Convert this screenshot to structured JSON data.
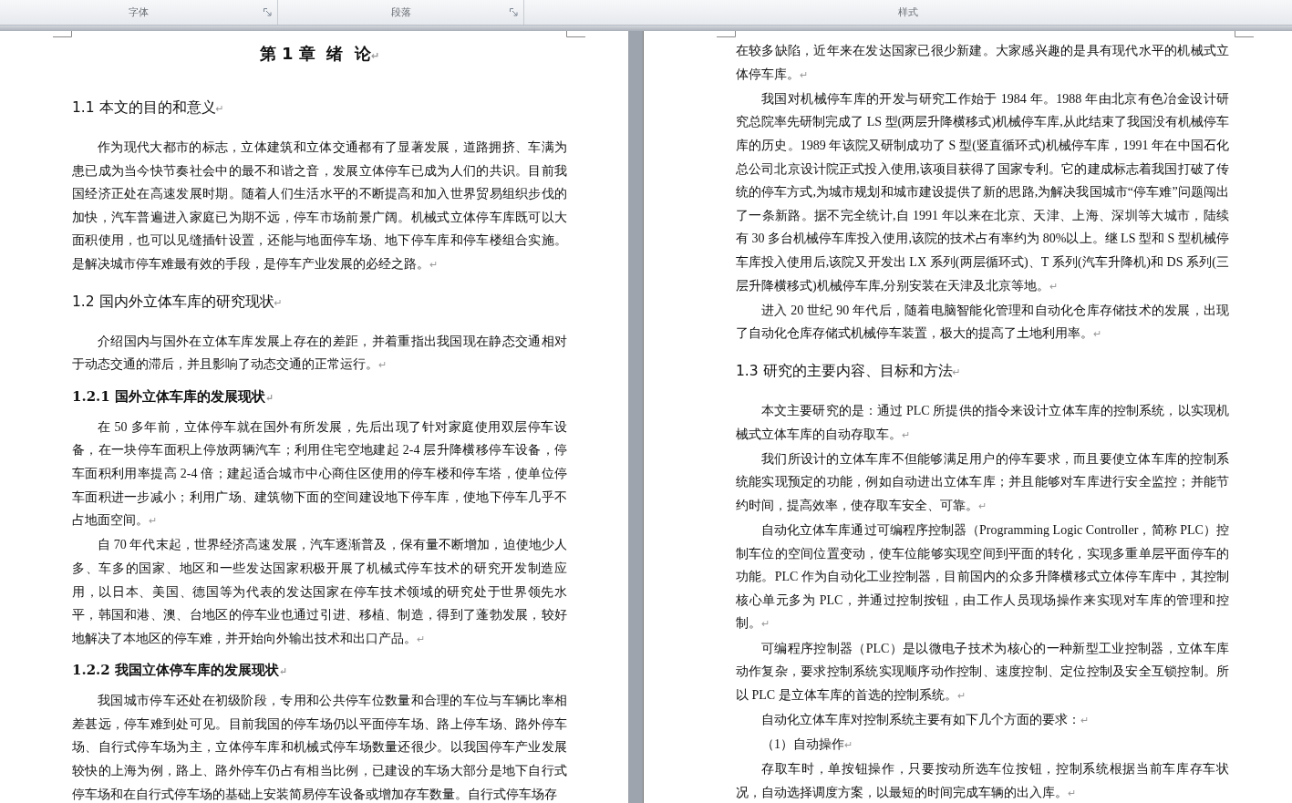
{
  "ribbon": {
    "groups": [
      {
        "label": "字体",
        "launcher": true
      },
      {
        "label": "段落",
        "launcher": true
      },
      {
        "label": "样式"
      }
    ]
  },
  "pages": [
    {
      "blocks": [
        {
          "kind": "title",
          "text": "第 1 章  绪  论",
          "end_mark": "↵"
        },
        {
          "kind": "heading2",
          "text": "1.1 本文的目的和意义",
          "end_mark": "↵"
        },
        {
          "kind": "paragraph",
          "text": "作为现代大都市的标志，立体建筑和立体交通都有了显著发展，道路拥挤、车满为患已成为当今快节奏社会中的最不和谐之音，发展立体停车已成为人们的共识。目前我国经济正处在高速发展时期。随着人们生活水平的不断提高和加入世界贸易组织步伐的加快，汽车普遍进入家庭已为期不远，停车市场前景广阔。机械式立体停车库既可以大面积使用，也可以见缝插针设置，还能与地面停车场、地下停车库和停车楼组合实施。是解决城市停车难最有效的手段，是停车产业发展的必经之路。",
          "end_mark": "↵"
        },
        {
          "kind": "heading2",
          "text": "1.2 国内外立体车库的研究现状",
          "end_mark": "↵"
        },
        {
          "kind": "paragraph",
          "text": "介绍国内与国外在立体车库发展上存在的差距，并着重指出我国现在静态交通相对于动态交通的滞后，并且影响了动态交通的正常运行。",
          "end_mark": "↵"
        },
        {
          "kind": "heading3",
          "text": "1.2.1 国外立体车库的发展现状",
          "end_mark": "↵"
        },
        {
          "kind": "paragraph",
          "text": "在 50 多年前，立体停车就在国外有所发展，先后出现了针对家庭使用双层停车设备，在一块停车面积上停放两辆汽车；利用住宅空地建起 2-4 层升降横移停车设备，停车面积利用率提高 2-4 倍；建起适合城市中心商住区使用的停车楼和停车塔，使单位停车面积进一步减小；利用广场、建筑物下面的空间建设地下停车库，使地下停车几乎不占地面空间。",
          "end_mark": "↵"
        },
        {
          "kind": "paragraph",
          "text": "自 70 年代末起，世界经济高速发展，汽车逐渐普及，保有量不断增加，迫使地少人多、车多的国家、地区和一些发达国家积极开展了机械式停车技术的研究开发制造应用，以日本、美国、德国等为代表的发达国家在停车技术领域的研究处于世界领先水平，韩国和港、澳、台地区的停车业也通过引进、移植、制造，得到了蓬勃发展，较好地解决了本地区的停车难，并开始向外输出技术和出口产品。",
          "end_mark": "↵"
        },
        {
          "kind": "heading3",
          "text": "1.2.2 我国立体停车库的发展现状",
          "end_mark": "↵"
        },
        {
          "kind": "paragraph",
          "text": "我国城市停车还处在初级阶段，专用和公共停车位数量和合理的车位与车辆比率相差甚远，停车难到处可见。目前我国的停车场仍以平面停车场、路上停车场、路外停车场、自行式停车场为主，立体停车库和机械式停车场数量还很少。以我国停车产业发展较快的上海为例，路上、路外停车仍占有相当比例，已建设的车场大部分是地下自行式停车场和在自行式停车场的基础上安装简易停车设备或增加存车数量。自行式停车场存"
        }
      ]
    },
    {
      "blocks": [
        {
          "kind": "continued",
          "text": "在较多缺陷，近年来在发达国家已很少新建。大家感兴趣的是具有现代水平的机械式立体停车库。",
          "end_mark": "↵"
        },
        {
          "kind": "paragraph",
          "text": "我国对机械停车库的开发与研究工作始于 1984 年。1988 年由北京有色冶金设计研究总院率先研制完成了 LS 型(两层升降横移式)机械停车库,从此结束了我国没有机械停车库的历史。1989 年该院又研制成功了 S 型(竖直循环式)机械停车库，1991 年在中国石化总公司北京设计院正式投入使用,该项目获得了国家专利。它的建成标志着我国打破了传统的停车方式,为城市规划和城市建设提供了新的思路,为解决我国城市“停车难”问题闯出了一条新路。据不完全统计,自 1991 年以来在北京、天津、上海、深圳等大城市，陆续有 30 多台机械停车库投入使用,该院的技术占有率约为 80%以上。继 LS 型和 S 型机械停车库投入使用后,该院又开发出 LX 系列(两层循环式)、T 系列(汽车升降机)和 DS 系列(三层升降横移式)机械停车库,分别安装在天津及北京等地。",
          "end_mark": "↵"
        },
        {
          "kind": "paragraph",
          "text": "进入 20 世纪 90 年代后，随着电脑智能化管理和自动化仓库存储技术的发展，出现了自动化仓库存储式机械停车装置，极大的提高了土地利用率。",
          "end_mark": "↵"
        },
        {
          "kind": "heading2",
          "text": "1.3 研究的主要内容、目标和方法",
          "end_mark": "↵"
        },
        {
          "kind": "paragraph",
          "text": "本文主要研究的是：通过 PLC 所提供的指令来设计立体车库的控制系统，以实现机械式立体车库的自动存取车。",
          "end_mark": "↵"
        },
        {
          "kind": "paragraph",
          "text": "我们所设计的立体车库不但能够满足用户的停车要求，而且要使立体车库的控制系统能实现预定的功能，例如自动进出立体车库；并且能够对车库进行安全监控；并能节约时间，提高效率，使存取车安全、可靠。",
          "end_mark": "↵"
        },
        {
          "kind": "paragraph",
          "text": "自动化立体车库通过可编程序控制器（Programming Logic Controller，简称 PLC）控制车位的空间位置变动，使车位能够实现空间到平面的转化，实现多重单层平面停车的功能。PLC 作为自动化工业控制器，目前国内的众多升降横移式立体停车库中，其控制核心单元多为 PLC，并通过控制按钮，由工作人员现场操作来实现对车库的管理和控制。",
          "end_mark": "↵"
        },
        {
          "kind": "paragraph",
          "text": "可编程序控制器（PLC）是以微电子技术为核心的一种新型工业控制器，立体车库动作复杂，要求控制系统实现顺序动作控制、速度控制、定位控制及安全互锁控制。所以 PLC 是立体车库的首选的控制系统。",
          "end_mark": "↵"
        },
        {
          "kind": "paragraph",
          "text": "自动化立体车库对控制系统主要有如下几个方面的要求：",
          "end_mark": "↵"
        },
        {
          "kind": "paragraph",
          "text": "（1）自动操作",
          "end_mark": "↵"
        },
        {
          "kind": "paragraph",
          "text": "存取车时，单按钮操作，只要按动所选车位按钮，控制系统根据当前车库存车状况，自动选择调度方案，以最短的时间完成车辆的出入库。",
          "end_mark": "↵"
        }
      ]
    }
  ]
}
